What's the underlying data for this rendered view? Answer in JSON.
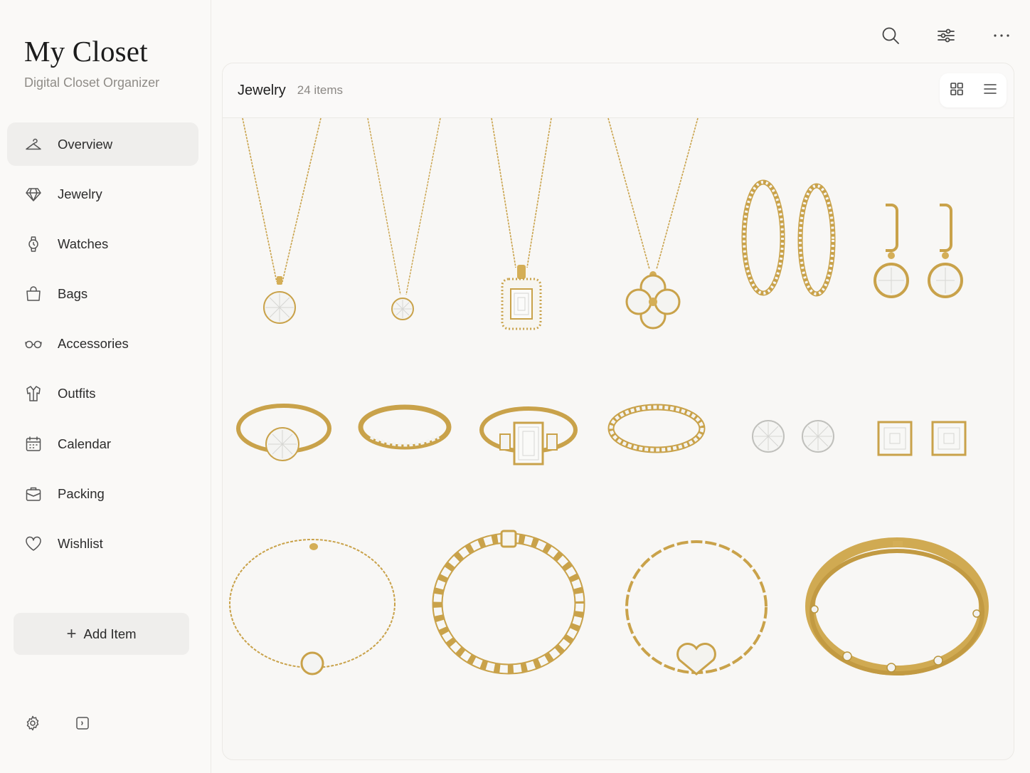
{
  "app": {
    "title": "My Closet",
    "subtitle": "Digital Closet Organizer"
  },
  "sidebar": {
    "items": [
      {
        "label": "Overview",
        "icon": "hanger-icon",
        "active": true
      },
      {
        "label": "Jewelry",
        "icon": "diamond-icon",
        "active": false
      },
      {
        "label": "Watches",
        "icon": "watch-icon",
        "active": false
      },
      {
        "label": "Bags",
        "icon": "bag-icon",
        "active": false
      },
      {
        "label": "Accessories",
        "icon": "glasses-icon",
        "active": false
      },
      {
        "label": "Outfits",
        "icon": "shirt-icon",
        "active": false
      },
      {
        "label": "Calendar",
        "icon": "calendar-icon",
        "active": false
      },
      {
        "label": "Packing",
        "icon": "suitcase-icon",
        "active": false
      },
      {
        "label": "Wishlist",
        "icon": "heart-icon",
        "active": false
      }
    ],
    "add_button": "Add Item",
    "bottom": [
      "settings-icon",
      "collapse-sidebar-icon"
    ]
  },
  "toolbar": {
    "icons": [
      "search-icon",
      "filter-sliders-icon",
      "more-icon"
    ]
  },
  "panel": {
    "title": "Jewelry",
    "count": "24 items",
    "view_modes": [
      "grid-view-icon",
      "list-view-icon"
    ],
    "selected_view": "grid"
  },
  "items": [
    {
      "name": "round-solitaire-pendant-necklace",
      "type": "necklace"
    },
    {
      "name": "small-solitaire-pendant-necklace",
      "type": "necklace"
    },
    {
      "name": "emerald-halo-pendant-necklace",
      "type": "necklace"
    },
    {
      "name": "clover-pendant-necklace",
      "type": "necklace"
    },
    {
      "name": "pave-hoop-earrings",
      "type": "earrings"
    },
    {
      "name": "round-drop-earrings",
      "type": "earrings"
    },
    {
      "name": "solitaire-engagement-ring",
      "type": "ring"
    },
    {
      "name": "half-eternity-band",
      "type": "ring"
    },
    {
      "name": "emerald-cut-three-stone-ring",
      "type": "ring"
    },
    {
      "name": "full-eternity-band",
      "type": "ring"
    },
    {
      "name": "round-stud-earrings",
      "type": "earrings"
    },
    {
      "name": "asscher-stud-earrings",
      "type": "earrings"
    },
    {
      "name": "solitaire-chain-bracelet",
      "type": "bracelet"
    },
    {
      "name": "tennis-bracelet",
      "type": "bracelet"
    },
    {
      "name": "heart-charm-link-bracelet",
      "type": "bracelet"
    },
    {
      "name": "gold-bangle-with-stones",
      "type": "bracelet"
    }
  ],
  "colors": {
    "gold": "#c9a24a",
    "background": "#faf9f7",
    "active_nav": "#efeeec"
  }
}
